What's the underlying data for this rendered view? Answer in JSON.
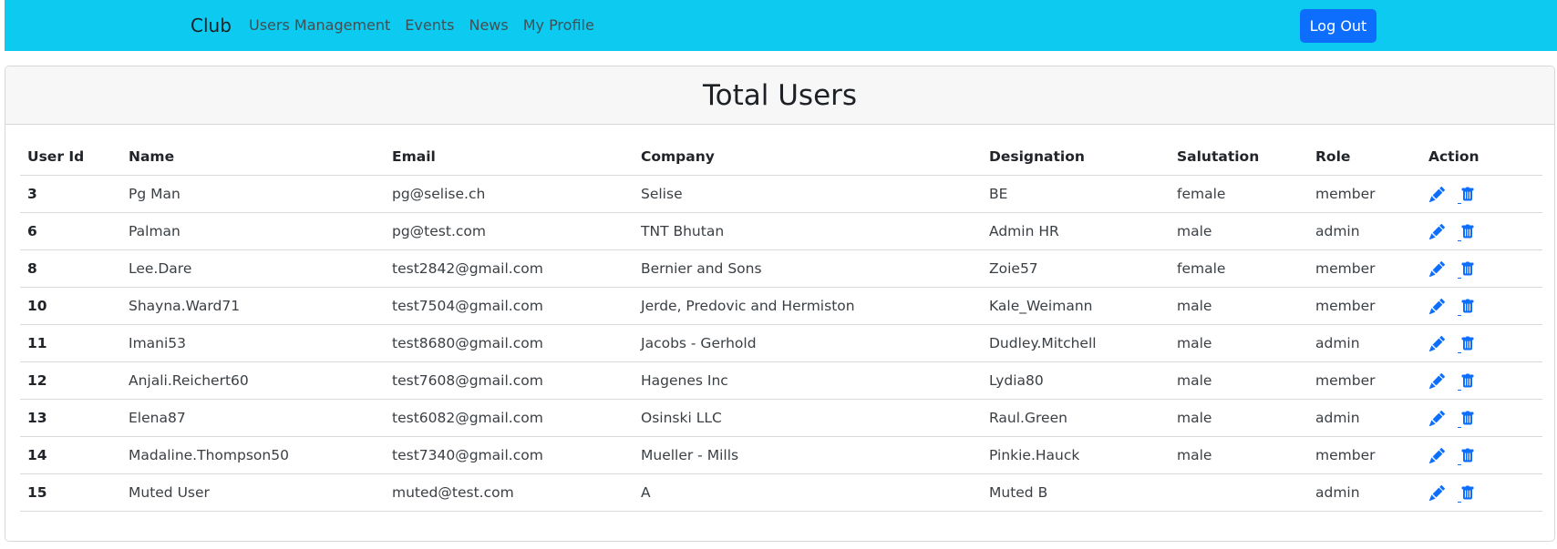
{
  "nav": {
    "brand": "Club",
    "links": [
      "Users Management",
      "Events",
      "News",
      "My Profile"
    ],
    "logout_label": "Log Out"
  },
  "page": {
    "title": "Total Users"
  },
  "table": {
    "headers": [
      "User Id",
      "Name",
      "Email",
      "Company",
      "Designation",
      "Salutation",
      "Role",
      "Action"
    ],
    "rows": [
      {
        "id": "3",
        "name": "Pg Man",
        "email": "pg@selise.ch",
        "company": "Selise",
        "designation": "BE",
        "salutation": "female",
        "role": "member"
      },
      {
        "id": "6",
        "name": "Palman",
        "email": "pg@test.com",
        "company": "TNT Bhutan",
        "designation": "Admin HR",
        "salutation": "male",
        "role": "admin"
      },
      {
        "id": "8",
        "name": "Lee.Dare",
        "email": "test2842@gmail.com",
        "company": "Bernier and Sons",
        "designation": "Zoie57",
        "salutation": "female",
        "role": "member"
      },
      {
        "id": "10",
        "name": "Shayna.Ward71",
        "email": "test7504@gmail.com",
        "company": "Jerde, Predovic and Hermiston",
        "designation": "Kale_Weimann",
        "salutation": "male",
        "role": "member"
      },
      {
        "id": "11",
        "name": "Imani53",
        "email": "test8680@gmail.com",
        "company": "Jacobs - Gerhold",
        "designation": "Dudley.Mitchell",
        "salutation": "male",
        "role": "admin"
      },
      {
        "id": "12",
        "name": "Anjali.Reichert60",
        "email": "test7608@gmail.com",
        "company": "Hagenes Inc",
        "designation": "Lydia80",
        "salutation": "male",
        "role": "member"
      },
      {
        "id": "13",
        "name": "Elena87",
        "email": "test6082@gmail.com",
        "company": "Osinski LLC",
        "designation": "Raul.Green",
        "salutation": "male",
        "role": "admin"
      },
      {
        "id": "14",
        "name": "Madaline.Thompson50",
        "email": "test7340@gmail.com",
        "company": "Mueller - Mills",
        "designation": "Pinkie.Hauck",
        "salutation": "male",
        "role": "member"
      },
      {
        "id": "15",
        "name": "Muted User",
        "email": "muted@test.com",
        "company": "A",
        "designation": "Muted B",
        "salutation": "",
        "role": "admin"
      }
    ],
    "row_icons": [
      "pencil-icon",
      "trash-icon"
    ]
  },
  "colors": {
    "navbar": "#0dcaf0",
    "primary": "#0d6efd"
  }
}
